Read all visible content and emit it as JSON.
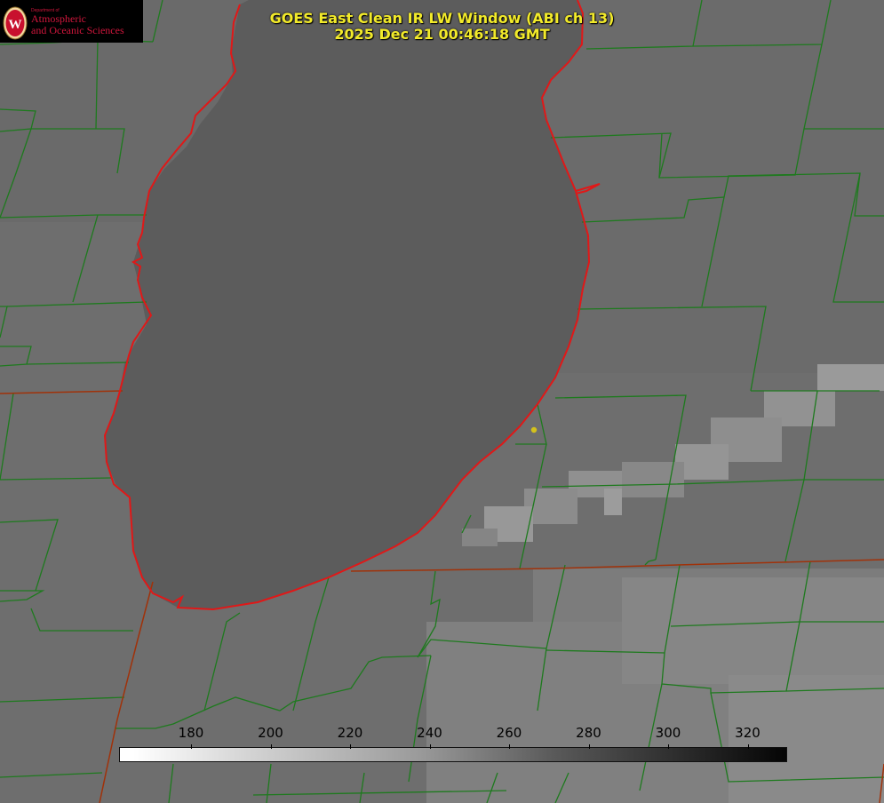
{
  "title": {
    "line1": "GOES East Clean IR LW Window (ABI ch 13)",
    "line2": "2025 Dec 21 00:46:18 GMT"
  },
  "logo": {
    "dept": "Department of",
    "line1": "Atmospheric",
    "line2": "and Oceanic Sciences",
    "seal_letter": "W"
  },
  "colorbar": {
    "ticks": [
      "180",
      "200",
      "220",
      "240",
      "260",
      "280",
      "300",
      "320"
    ]
  },
  "colors": {
    "title": "#f2ea2a",
    "county_border": "#1e7a1e",
    "shoreline": "#e01818",
    "state_border": "#a0320a",
    "marker": "#d4c21c"
  }
}
